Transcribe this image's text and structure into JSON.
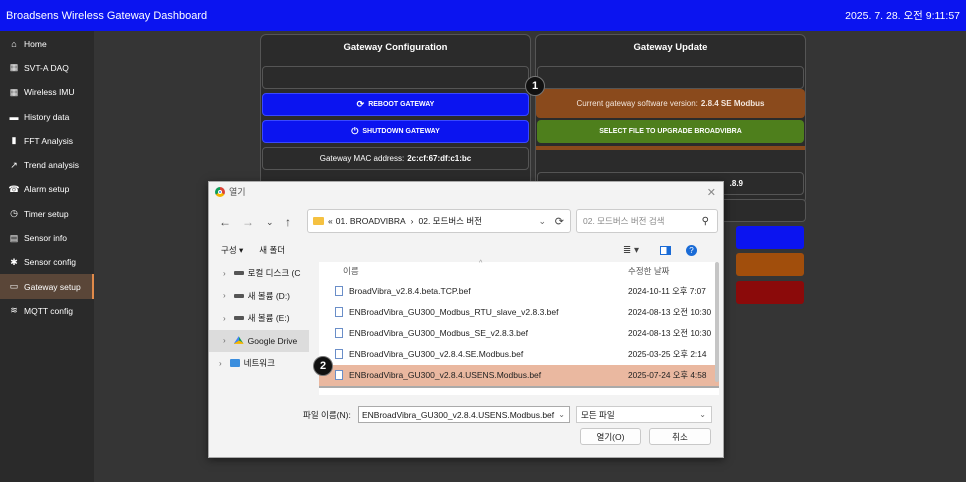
{
  "topbar": {
    "title": "Broadsens Wireless Gateway Dashboard",
    "clock": "2025. 7. 28. 오전 9:11:57"
  },
  "sidebar": {
    "items": [
      {
        "label": "Home",
        "icon": "home-icon",
        "glyph": "⌂"
      },
      {
        "label": "SVT-A DAQ",
        "icon": "grid-icon",
        "glyph": "▦"
      },
      {
        "label": "Wireless IMU",
        "icon": "grid-icon",
        "glyph": "▦"
      },
      {
        "label": "History data",
        "icon": "folder-icon",
        "glyph": "▬"
      },
      {
        "label": "FFT Analysis",
        "icon": "bar-chart-icon",
        "glyph": "▮"
      },
      {
        "label": "Trend analysis",
        "icon": "trend-icon",
        "glyph": "↗"
      },
      {
        "label": "Alarm setup",
        "icon": "alarm-icon",
        "glyph": "☎"
      },
      {
        "label": "Timer setup",
        "icon": "clock-icon",
        "glyph": "◷"
      },
      {
        "label": "Sensor info",
        "icon": "info-card-icon",
        "glyph": "▤"
      },
      {
        "label": "Sensor config",
        "icon": "gear-icon",
        "glyph": "✱"
      },
      {
        "label": "Gateway setup",
        "icon": "laptop-icon",
        "glyph": "▭",
        "active": true
      },
      {
        "label": "MQTT config",
        "icon": "wifi-icon",
        "glyph": "≋"
      }
    ]
  },
  "config_panel": {
    "title": "Gateway Configuration",
    "reboot": "REBOOT GATEWAY",
    "shutdown": "SHUTDOWN GATEWAY",
    "mac_label": "Gateway MAC address:",
    "mac_value": "2c:cf:67:df:c1:bc"
  },
  "update_panel": {
    "title": "Gateway Update",
    "version_label": "Current gateway software version:",
    "version_value": "2.8.4 SE Modbus",
    "select": "SELECT FILE TO UPGRADE BROADVIBRA",
    "partial": ".8.9"
  },
  "badges": {
    "one": "1",
    "two": "2"
  },
  "colors": {
    "blue": "#0b14f0",
    "orange": "#8a4a1c",
    "green": "#4e7f1c",
    "red": "#8b0a0a",
    "selected_file": "#eab8a0"
  },
  "dialog": {
    "title": "열기",
    "breadcrumb_prefix": "«",
    "breadcrumb_1": "01. BROADVIBRA",
    "breadcrumb_sep": "›",
    "breadcrumb_2": "02. 모드버스 버전",
    "search_placeholder": "02. 모드버스 버전 검색",
    "organize": "구성 ▾",
    "new_folder": "새 폴더",
    "nav": [
      {
        "label": "로컬 디스크 (C",
        "kind": "drive"
      },
      {
        "label": "새 볼륨 (D:)",
        "kind": "drive"
      },
      {
        "label": "새 볼륨 (E:)",
        "kind": "drive"
      },
      {
        "label": "Google Drive",
        "kind": "gdrive",
        "selected": true
      },
      {
        "label": "네트워크",
        "kind": "network"
      }
    ],
    "col_name": "이름",
    "col_date": "수정한 날짜",
    "files": [
      {
        "name": "BroadVibra_v2.8.4.beta.TCP.bef",
        "date": "2024-10-11 오후 7:07"
      },
      {
        "name": "ENBroadVibra_GU300_Modbus_RTU_slave_v2.8.3.bef",
        "date": "2024-08-13 오전 10:30"
      },
      {
        "name": "ENBroadVibra_GU300_Modbus_SE_v2.8.3.bef",
        "date": "2024-08-13 오전 10:30"
      },
      {
        "name": "ENBroadVibra_GU300_v2.8.4.SE.Modbus.bef",
        "date": "2025-03-25 오후 2:14"
      },
      {
        "name": "ENBroadVibra_GU300_v2.8.4.USENS.Modbus.bef",
        "date": "2025-07-24 오후 4:58",
        "selected": true
      }
    ],
    "filename_label": "파일 이름(N):",
    "filename_value": "ENBroadVibra_GU300_v2.8.4.USENS.Modbus.bef",
    "filetype": "모든 파일",
    "open": "열기(O)",
    "cancel": "취소"
  }
}
